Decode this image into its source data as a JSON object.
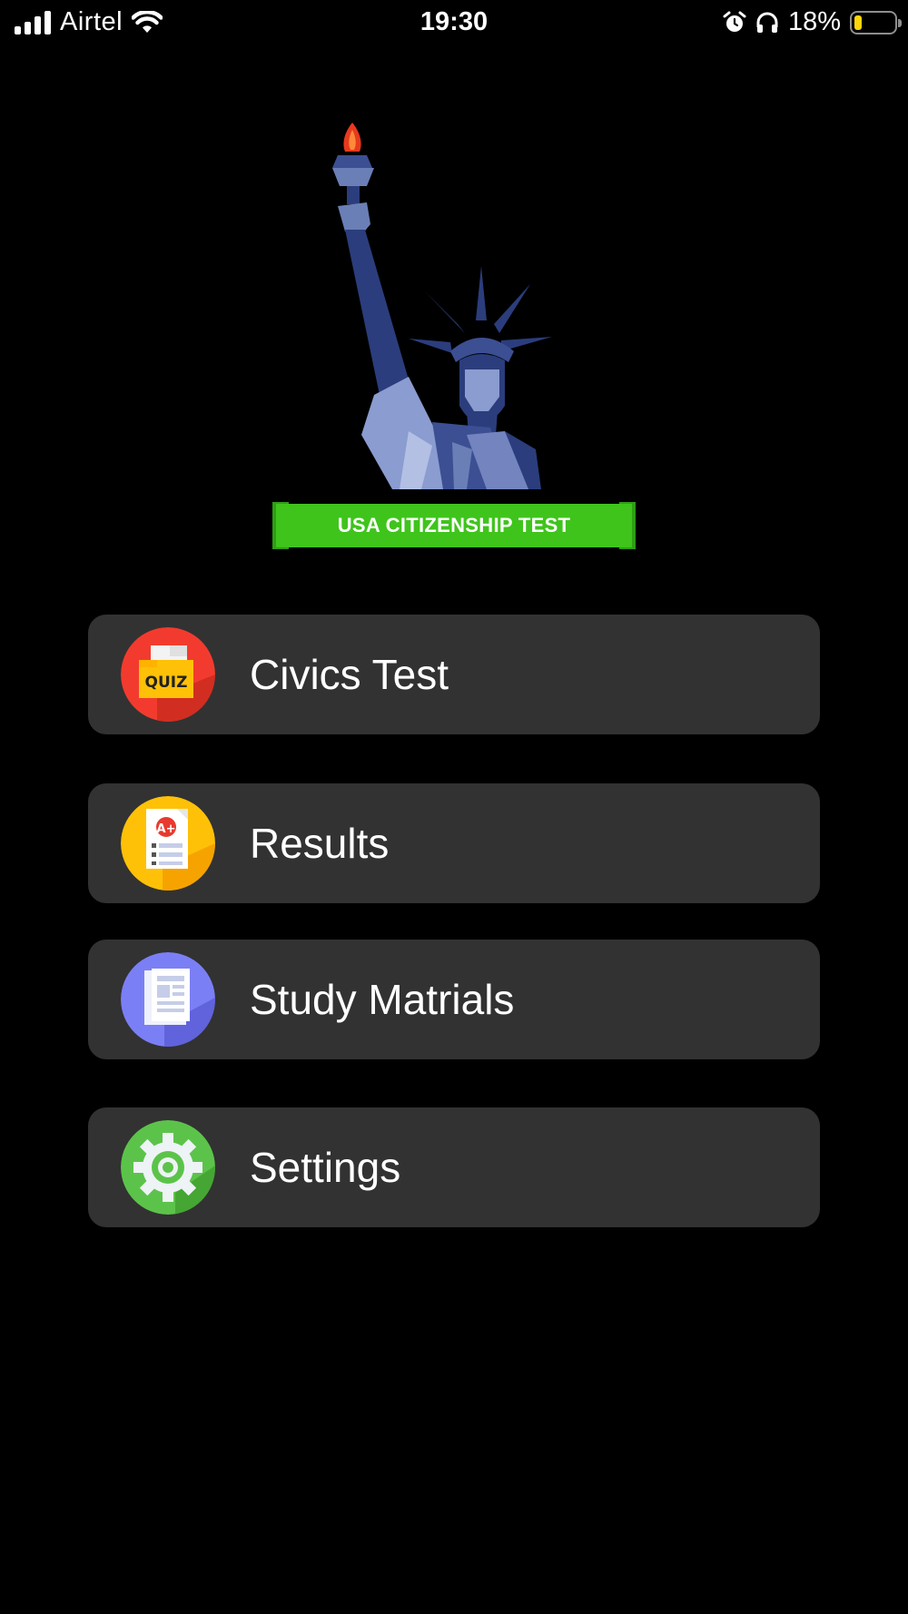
{
  "status_bar": {
    "carrier": "Airtel",
    "time": "19:30",
    "battery_percent": "18%",
    "battery_level": 0.18,
    "icons": [
      "signal-icon",
      "wifi-icon",
      "alarm-icon",
      "headphones-icon",
      "battery-icon"
    ]
  },
  "logo": {
    "ribbon_text": "USA CITIZENSHIP TEST"
  },
  "menu": {
    "items": [
      {
        "label": "Civics Test",
        "icon": "quiz-icon",
        "color": "#f23b2e"
      },
      {
        "label": "Results",
        "icon": "grade-report-icon",
        "color": "#ffc107"
      },
      {
        "label": "Study Matrials",
        "icon": "document-icon",
        "color": "#7b7ff5"
      },
      {
        "label": "Settings",
        "icon": "gear-icon",
        "color": "#5cc34a"
      }
    ]
  },
  "colors": {
    "background": "#000000",
    "card": "#323232",
    "ribbon": "#3fc41c",
    "statue": "#2b3d7c"
  }
}
